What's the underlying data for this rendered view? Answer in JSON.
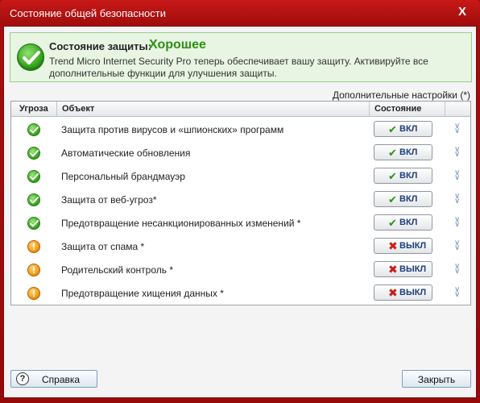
{
  "window": {
    "title": "Состояние общей безопасности",
    "close_glyph": "X"
  },
  "status": {
    "label": "Состояние защиты:",
    "value": "Хорошее",
    "description": "Trend Micro Internet Security Pro теперь обеспечивает вашу защиту. Активируйте все дополнительные функции для улучшения защиты.",
    "icon": "green-check-icon"
  },
  "extra_settings_link": "Дополнительные настройки (*)",
  "table": {
    "headers": {
      "threat": "Угроза",
      "object": "Объект",
      "state": "Состояние"
    },
    "rows": [
      {
        "status": "ok",
        "object": "Защита против вирусов и «шпионских» программ",
        "state": "ВКЛ"
      },
      {
        "status": "ok",
        "object": "Автоматические обновления",
        "state": "ВКЛ"
      },
      {
        "status": "ok",
        "object": "Персональный брандмауэр",
        "state": "ВКЛ"
      },
      {
        "status": "ok",
        "object": "Защита от веб-угроз*",
        "state": "ВКЛ"
      },
      {
        "status": "ok",
        "object": "Предотвращение несанкционированных изменений *",
        "state": "ВКЛ"
      },
      {
        "status": "warn",
        "object": "Защита от спама *",
        "state": "ВЫКЛ"
      },
      {
        "status": "warn",
        "object": "Родительский контроль *",
        "state": "ВЫКЛ"
      },
      {
        "status": "warn",
        "object": "Предотвращение хищения данных *",
        "state": "ВЫКЛ"
      }
    ]
  },
  "buttons": {
    "help": "Справка",
    "close": "Закрыть"
  },
  "colors": {
    "window_frame": "#a30d0d",
    "status_ok": "#2f8f14",
    "status_warn": "#f59b12",
    "toggle_off": "#d01818"
  }
}
